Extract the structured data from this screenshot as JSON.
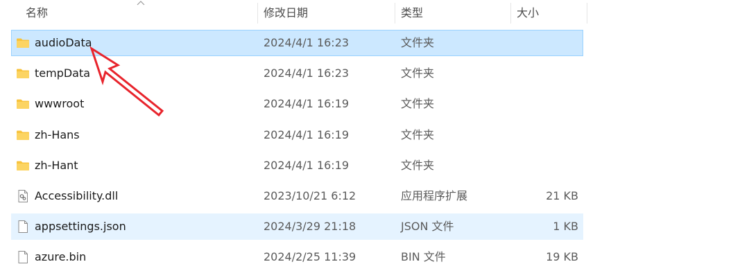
{
  "columns": {
    "name": "名称",
    "date": "修改日期",
    "type": "类型",
    "size": "大小"
  },
  "files": [
    {
      "name": "audioData",
      "date": "2024/4/1 16:23",
      "type": "文件夹",
      "size": "",
      "icon": "folder-icon",
      "state": "selected"
    },
    {
      "name": "tempData",
      "date": "2024/4/1 16:23",
      "type": "文件夹",
      "size": "",
      "icon": "folder-icon",
      "state": ""
    },
    {
      "name": "wwwroot",
      "date": "2024/4/1 16:19",
      "type": "文件夹",
      "size": "",
      "icon": "folder-icon",
      "state": ""
    },
    {
      "name": "zh-Hans",
      "date": "2024/4/1 16:19",
      "type": "文件夹",
      "size": "",
      "icon": "folder-icon",
      "state": ""
    },
    {
      "name": "zh-Hant",
      "date": "2024/4/1 16:19",
      "type": "文件夹",
      "size": "",
      "icon": "folder-icon",
      "state": ""
    },
    {
      "name": "Accessibility.dll",
      "date": "2023/10/21 6:12",
      "type": "应用程序扩展",
      "size": "21 KB",
      "icon": "dll-file-icon",
      "state": ""
    },
    {
      "name": "appsettings.json",
      "date": "2024/3/29 21:18",
      "type": "JSON 文件",
      "size": "1 KB",
      "icon": "file-icon",
      "state": "hovered"
    },
    {
      "name": "azure.bin",
      "date": "2024/2/25 11:39",
      "type": "BIN 文件",
      "size": "19 KB",
      "icon": "file-icon",
      "state": ""
    }
  ],
  "colors": {
    "selected_bg": "#cce8ff",
    "selected_border": "#99d1ff",
    "hover_bg": "#e5f3ff",
    "folder": "#f8c33c",
    "annotation_arrow": "#e8242c"
  }
}
